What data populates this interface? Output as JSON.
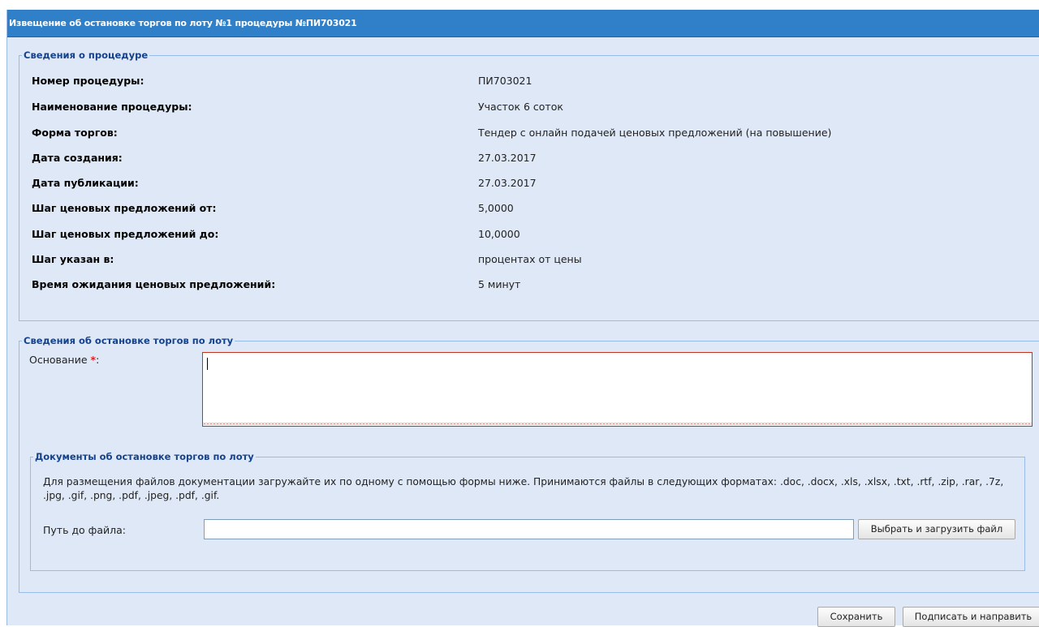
{
  "window": {
    "title": "Извещение об остановке торгов по лоту №1 процедуры №ПИ703021"
  },
  "procedure_section": {
    "legend": "Сведения о процедуре",
    "fields": [
      {
        "label": "Номер процедуры:",
        "value": "ПИ703021"
      },
      {
        "label": "Наименование процедуры:",
        "value": "Участок 6 соток"
      },
      {
        "label": "Форма торгов:",
        "value": "Тендер с онлайн подачей ценовых предложений (на повышение)"
      },
      {
        "label": "Дата создания:",
        "value": "27.03.2017"
      },
      {
        "label": "Дата публикации:",
        "value": "27.03.2017"
      },
      {
        "label": "Шаг ценовых предложений от:",
        "value": "5,0000"
      },
      {
        "label": "Шаг ценовых предложений до:",
        "value": "10,0000"
      },
      {
        "label": "Шаг указан в:",
        "value": "процентах от цены"
      },
      {
        "label": "Время ожидания ценовых предложений:",
        "value": "5 минут"
      }
    ]
  },
  "stop_section": {
    "legend": "Сведения об остановке торгов по лоту",
    "reason_label": "Основание",
    "required_mark": "*",
    "reason_suffix": ":",
    "reason_value": ""
  },
  "documents_section": {
    "legend": "Документы об остановке торгов по лоту",
    "description": "Для размещения файлов документации загружайте их по одному с помощью формы ниже. Принимаются файлы в следующих форматах: .doc, .docx, .xls, .xlsx, .txt, .rtf, .zip, .rar, .7z, .jpg, .gif, .png, .pdf, .jpeg, .pdf, .gif.",
    "file_path_label": "Путь до файла:",
    "file_path_value": "",
    "upload_button": "Выбрать и загрузить файл"
  },
  "actions": {
    "save_button": "Сохранить",
    "sign_send_button": "Подписать и направить"
  },
  "colors": {
    "titlebar": "#2f80c8",
    "panel_background": "#dfe8f6",
    "legend_text": "#15428b",
    "border": "#99bbe8",
    "required_mark": "#e02020",
    "invalid_border": "#c3311f"
  }
}
